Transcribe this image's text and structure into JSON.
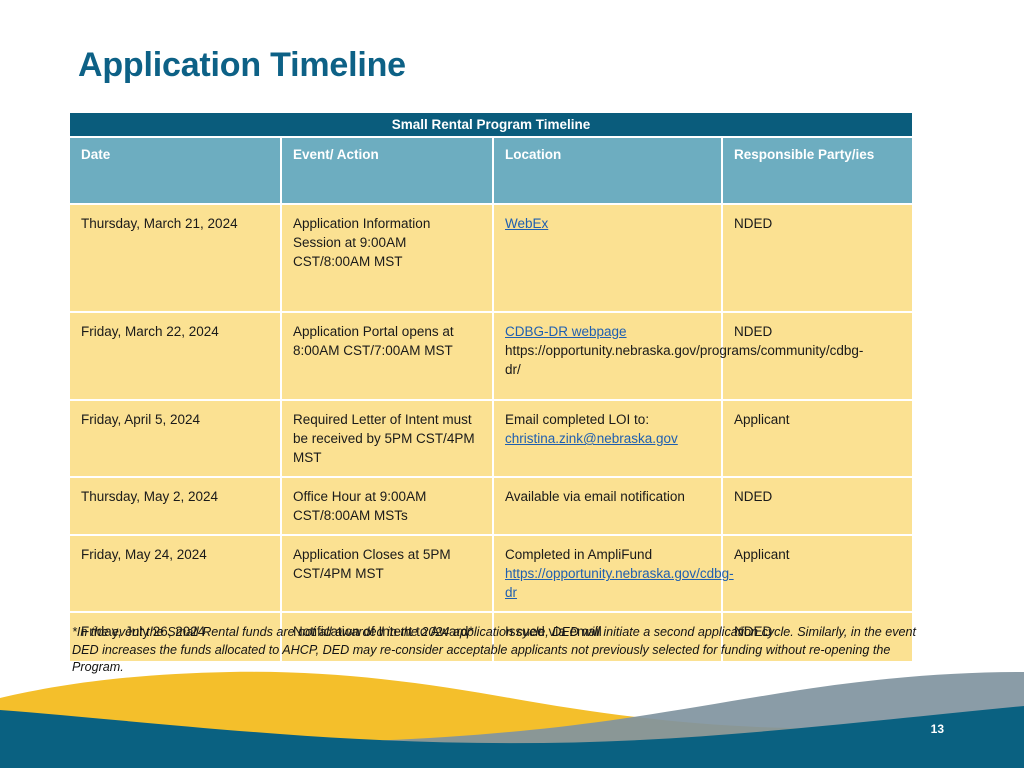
{
  "slide": {
    "title": "Application Timeline",
    "page_number": "13"
  },
  "table": {
    "caption": "Small Rental Program Timeline",
    "columns": [
      "Date",
      "Event/ Action",
      "Location",
      "Responsible Party/ies"
    ],
    "rows": [
      {
        "date": "Thursday, March 21, 2024",
        "event": "Application Information Session at 9:00AM CST/8:00AM MST",
        "location_link": "WebEx",
        "location_text": "",
        "responsible": "NDED"
      },
      {
        "date": "Friday, March 22, 2024",
        "event": "Application Portal opens at 8:00AM CST/7:00AM MST",
        "location_link": "CDBG-DR webpage",
        "location_text": "https://opportunity.nebraska.gov/programs/community/cdbg-dr/",
        "responsible": "NDED"
      },
      {
        "date": "Friday, April 5, 2024",
        "event": "Required Letter of Intent must be received by 5PM CST/4PM MST",
        "location_text": "Email completed LOI to:",
        "location_link": "christina.zink@nebraska.gov",
        "responsible": "Applicant"
      },
      {
        "date": "Thursday, May 2, 2024",
        "event": "Office Hour at 9:00AM CST/8:00AM MSTs",
        "location_text": "Available via email notification",
        "location_link": "",
        "responsible": "NDED"
      },
      {
        "date": "Friday, May 24, 2024",
        "event": "Application Closes at 5PM CST/4PM MST",
        "location_text": "Completed in AmpliFund",
        "location_link": "https://opportunity.nebraska.gov/cdbg-dr",
        "responsible": "Applicant"
      },
      {
        "date": "Friday, July 26, 2024",
        "event": "Notification of Intent to Award*",
        "location_text": "Issued via email",
        "location_link": "",
        "responsible": "NDED"
      }
    ]
  },
  "footnote": {
    "text": "*In the event the Small Rental funds are not all awarded in the 2024 application cycle, DED will initiate a second application cycle. Similarly, in the event DED increases the funds allocated to AHCP, DED may re-consider acceptable applicants not previously selected for funding without re-opening the Program."
  },
  "colors": {
    "title_blue": "#0d6186",
    "table_header_dark": "#0a5c7c",
    "column_header_blue": "#6dadc0",
    "cell_yellow": "#fbe192",
    "link_blue": "#1f5fb0",
    "wave_teal": "#0a6181",
    "wave_gold": "#f4bf2b",
    "wave_slate": "#8094a0"
  }
}
